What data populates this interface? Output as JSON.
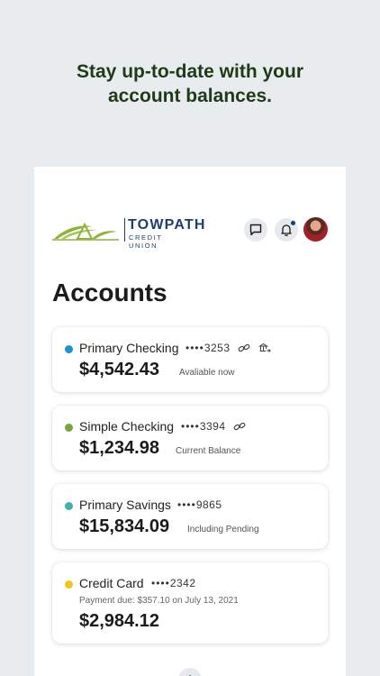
{
  "headline": {
    "line1": "Stay up-to-date with your",
    "line2": "account balances."
  },
  "brand": {
    "name": "TOWPATH",
    "subtitle": "CREDIT UNION",
    "color": "#1d3f6e",
    "leaf_color": "#8db33a"
  },
  "header_icons": [
    "chat-icon",
    "bell-icon",
    "avatar"
  ],
  "page_title": "Accounts",
  "accounts": [
    {
      "name": "Primary Checking",
      "mask_dots": "••••",
      "last4": "3253",
      "balance": "$4,542.43",
      "balance_label": "Avaliable now",
      "dot_color": "#1a93cf",
      "icons": [
        "link-icon",
        "bank-transfer-icon"
      ]
    },
    {
      "name": "Simple Checking",
      "mask_dots": "••••",
      "last4": "3394",
      "balance": "$1,234.98",
      "balance_label": "Current Balance",
      "dot_color": "#7aa33a",
      "icons": [
        "link-icon"
      ]
    },
    {
      "name": "Primary Savings",
      "mask_dots": "••••",
      "last4": "9865",
      "balance": "$15,834.09",
      "balance_label": "Including Pending",
      "dot_color": "#43b1a8",
      "icons": []
    },
    {
      "name": "Credit Card",
      "mask_dots": "••••",
      "last4": "2342",
      "payment_due": "Payment due: $357.10 on July 13, 2021",
      "balance": "$2,984.12",
      "dot_color": "#f2c51a",
      "icons": []
    }
  ],
  "add_button_icon": "plus-icon"
}
